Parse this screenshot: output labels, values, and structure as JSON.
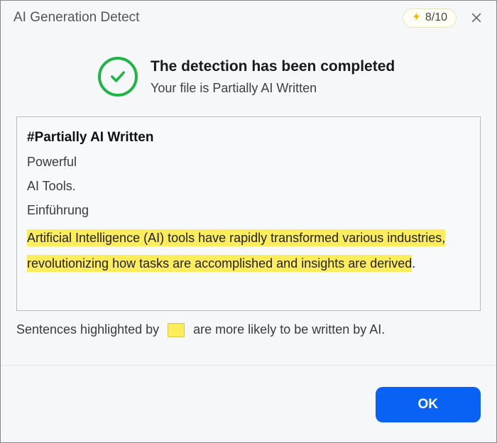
{
  "titlebar": {
    "title": "AI Generation Detect",
    "credits": "8/10"
  },
  "header": {
    "title": "The detection has been completed",
    "subtitle": "Your file is Partially AI Written"
  },
  "results": {
    "heading": "#Partially AI Written",
    "lines": [
      "Powerful",
      "AI Tools.",
      "Einführung"
    ],
    "highlighted": "Artificial Intelligence (AI) tools have rapidly transformed various industries, revolutionizing how tasks are accomplished and insights are derived"
  },
  "legend": {
    "prefix": "Sentences highlighted by",
    "suffix": "are more likely to be written by AI."
  },
  "footer": {
    "ok_label": "OK"
  }
}
